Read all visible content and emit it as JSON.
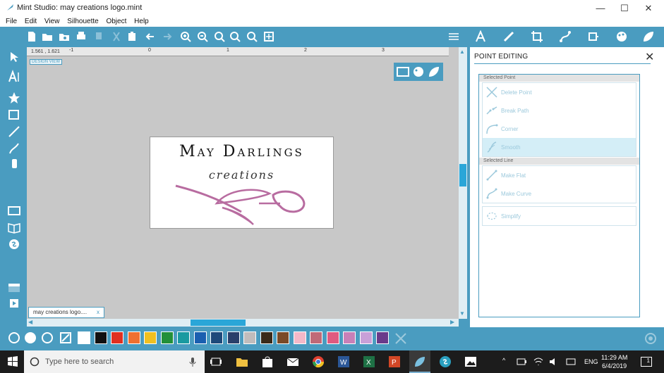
{
  "window": {
    "title": "Mint Studio: may creations logo.mint",
    "minimize": "—",
    "maximize": "☐",
    "close": "✕"
  },
  "menu": [
    "File",
    "Edit",
    "View",
    "Silhouette",
    "Object",
    "Help"
  ],
  "ruler": {
    "coords": "1.561 , 1.621",
    "ticks": [
      "-1",
      "0",
      "1",
      "2",
      "3"
    ]
  },
  "canvas": {
    "badge": "DESIGN VIEW",
    "tab_label": "may creations logo....",
    "tab_close": "x"
  },
  "logo": {
    "line1": "May Darlings",
    "line2": "creations",
    "flower_color": "#b86ca0"
  },
  "panel": {
    "title": "POINT EDITING",
    "selected_point_header": "Selected Point",
    "selected_point_items": [
      "Delete Point",
      "Break Path",
      "Corner",
      "Smooth"
    ],
    "selected_line_header": "Selected Line",
    "selected_line_items": [
      "Make Flat",
      "Make Curve"
    ],
    "simplify": "Simplify"
  },
  "swatches": [
    "#ffffff",
    "#111111",
    "#e03020",
    "#f07030",
    "#f0c020",
    "#22903a",
    "#1a9aa0",
    "#1a5fb0",
    "#1e4a7a",
    "#2a3f6a",
    "#c0bcbc",
    "#3a2a1a",
    "#7a4a28",
    "#f4b8c8",
    "#c06a78",
    "#e05a80",
    "#c880b8",
    "#c8a0d8",
    "#6a3a8a"
  ],
  "taskbar": {
    "search_placeholder": "Type here to search",
    "lang": "ENG",
    "time": "11:29 AM",
    "date": "6/4/2019",
    "notif": "1"
  },
  "colors": {
    "accent": "#4a9cc0",
    "panel_text": "#9cc9dc",
    "selected": "#d4eef7"
  }
}
